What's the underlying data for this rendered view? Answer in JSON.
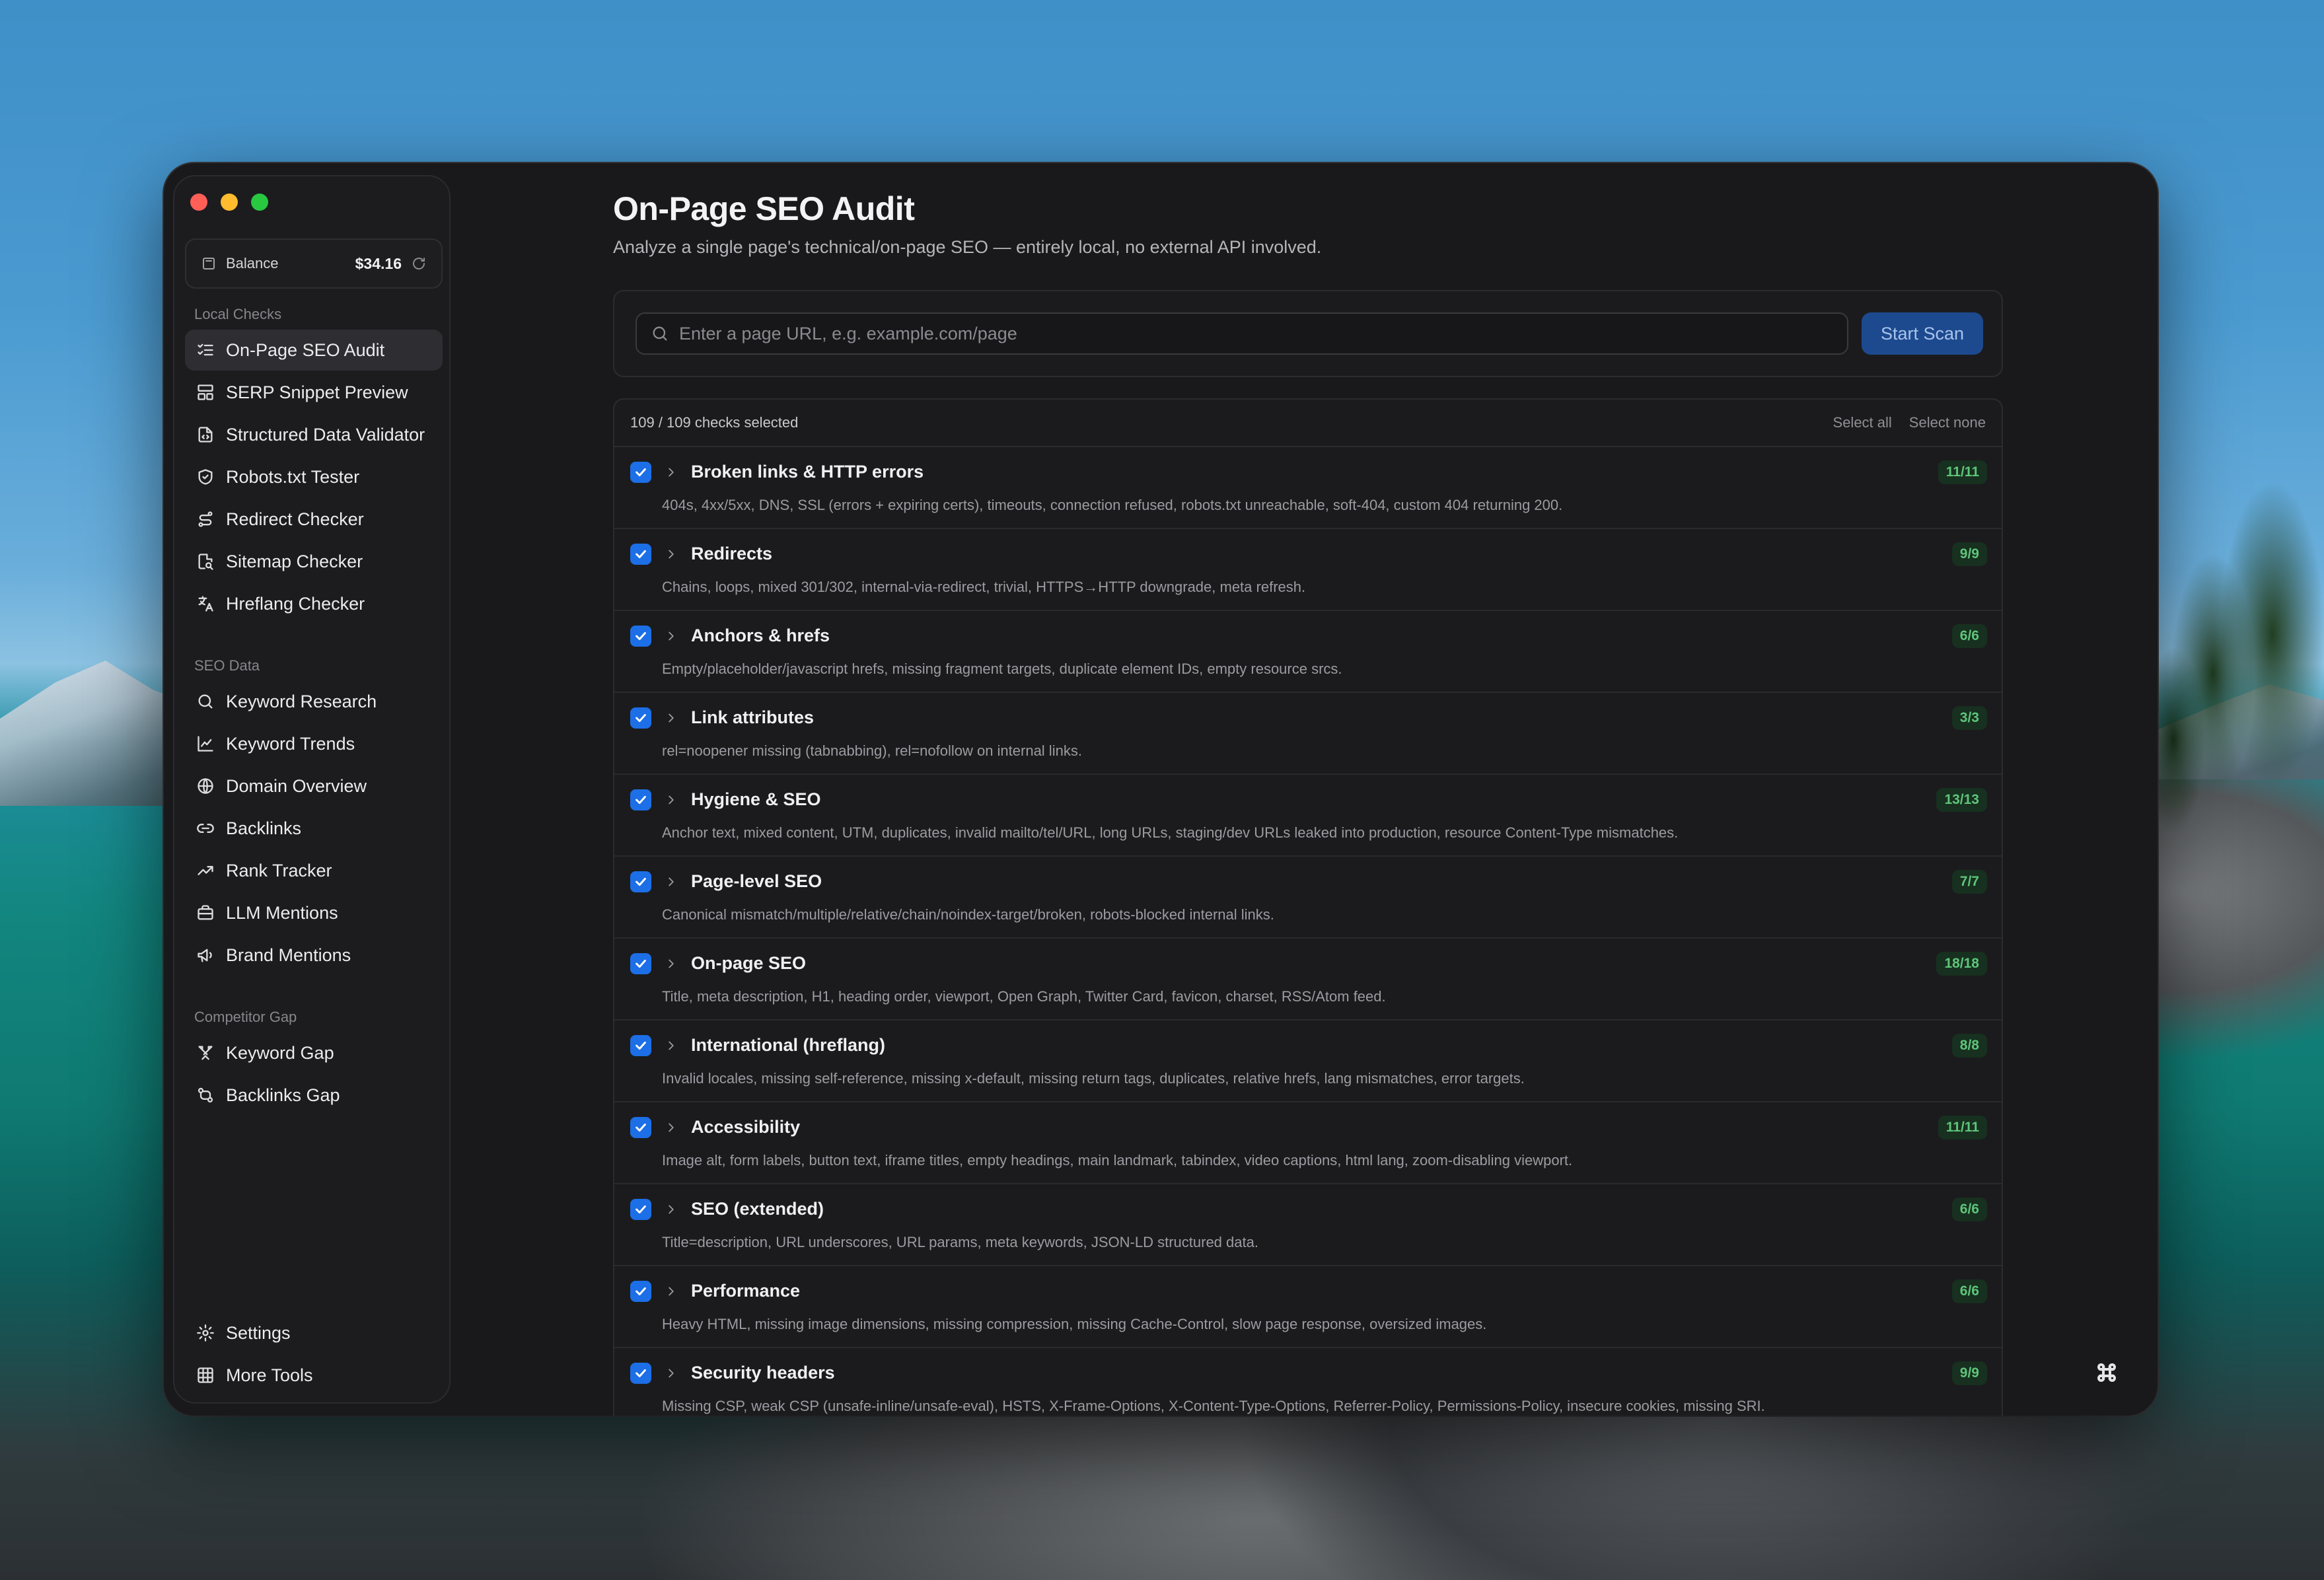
{
  "window": {
    "title": "On-Page SEO Audit"
  },
  "sidebar": {
    "balance": {
      "label": "Balance",
      "amount": "$34.16"
    },
    "sections": [
      {
        "label": "Local Checks",
        "items": [
          {
            "label": "On-Page SEO Audit",
            "icon": "checklist-icon",
            "active": true
          },
          {
            "label": "SERP Snippet Preview",
            "icon": "layout-icon"
          },
          {
            "label": "Structured Data Validator",
            "icon": "file-code-icon"
          },
          {
            "label": "Robots.txt Tester",
            "icon": "shield-check-icon"
          },
          {
            "label": "Redirect Checker",
            "icon": "route-icon"
          },
          {
            "label": "Sitemap Checker",
            "icon": "file-search-icon"
          },
          {
            "label": "Hreflang Checker",
            "icon": "translate-icon"
          }
        ]
      },
      {
        "label": "SEO Data",
        "items": [
          {
            "label": "Keyword Research",
            "icon": "search-icon"
          },
          {
            "label": "Keyword Trends",
            "icon": "line-chart-icon"
          },
          {
            "label": "Domain Overview",
            "icon": "globe-icon"
          },
          {
            "label": "Backlinks",
            "icon": "link-icon"
          },
          {
            "label": "Rank Tracker",
            "icon": "trending-up-icon"
          },
          {
            "label": "LLM Mentions",
            "icon": "briefcase-icon"
          },
          {
            "label": "Brand Mentions",
            "icon": "megaphone-icon"
          }
        ]
      },
      {
        "label": "Competitor Gap",
        "items": [
          {
            "label": "Keyword Gap",
            "icon": "swords-icon"
          },
          {
            "label": "Backlinks Gap",
            "icon": "git-compare-icon"
          }
        ]
      }
    ],
    "footer": [
      {
        "label": "Settings",
        "icon": "gear-icon"
      },
      {
        "label": "More Tools",
        "icon": "grid-icon"
      }
    ]
  },
  "main": {
    "title": "On-Page SEO Audit",
    "subtitle": "Analyze a single page's technical/on-page SEO — entirely local, no external API involved.",
    "url_input": {
      "placeholder": "Enter a page URL, e.g. example.com/page",
      "value": ""
    },
    "start_button": "Start Scan",
    "checks_summary": "109 / 109 checks selected",
    "select_all": "Select all",
    "select_none": "Select none",
    "checks": [
      {
        "title": "Broken links & HTTP errors",
        "desc": "404s, 4xx/5xx, DNS, SSL (errors + expiring certs), timeouts, connection refused, robots.txt unreachable, soft-404, custom 404 returning 200.",
        "count": "11/11",
        "checked": true
      },
      {
        "title": "Redirects",
        "desc": "Chains, loops, mixed 301/302, internal-via-redirect, trivial, HTTPS→HTTP downgrade, meta refresh.",
        "count": "9/9",
        "checked": true
      },
      {
        "title": "Anchors & hrefs",
        "desc": "Empty/placeholder/javascript hrefs, missing fragment targets, duplicate element IDs, empty resource srcs.",
        "count": "6/6",
        "checked": true
      },
      {
        "title": "Link attributes",
        "desc": "rel=noopener missing (tabnabbing), rel=nofollow on internal links.",
        "count": "3/3",
        "checked": true
      },
      {
        "title": "Hygiene & SEO",
        "desc": "Anchor text, mixed content, UTM, duplicates, invalid mailto/tel/URL, long URLs, staging/dev URLs leaked into production, resource Content-Type mismatches.",
        "count": "13/13",
        "checked": true
      },
      {
        "title": "Page-level SEO",
        "desc": "Canonical mismatch/multiple/relative/chain/noindex-target/broken, robots-blocked internal links.",
        "count": "7/7",
        "checked": true
      },
      {
        "title": "On-page SEO",
        "desc": "Title, meta description, H1, heading order, viewport, Open Graph, Twitter Card, favicon, charset, RSS/Atom feed.",
        "count": "18/18",
        "checked": true
      },
      {
        "title": "International (hreflang)",
        "desc": "Invalid locales, missing self-reference, missing x-default, missing return tags, duplicates, relative hrefs, lang mismatches, error targets.",
        "count": "8/8",
        "checked": true
      },
      {
        "title": "Accessibility",
        "desc": "Image alt, form labels, button text, iframe titles, empty headings, main landmark, tabindex, video captions, html lang, zoom-disabling viewport.",
        "count": "11/11",
        "checked": true
      },
      {
        "title": "SEO (extended)",
        "desc": "Title=description, URL underscores, URL params, meta keywords, JSON-LD structured data.",
        "count": "6/6",
        "checked": true
      },
      {
        "title": "Performance",
        "desc": "Heavy HTML, missing image dimensions, missing compression, missing Cache-Control, slow page response, oversized images.",
        "count": "6/6",
        "checked": true
      },
      {
        "title": "Security headers",
        "desc": "Missing CSP, weak CSP (unsafe-inline/unsafe-eval), HSTS, X-Frame-Options, X-Content-Type-Options, Referrer-Policy, Permissions-Policy, insecure cookies, missing SRI.",
        "count": "9/9",
        "checked": true
      }
    ]
  },
  "colors": {
    "accent": "#1c6fe6",
    "count_text": "#5fc57a",
    "background": "#19191b"
  }
}
